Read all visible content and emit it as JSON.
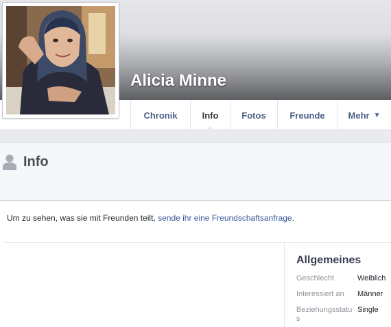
{
  "profile": {
    "name": "Alicia Minne"
  },
  "nav": {
    "tabs": [
      {
        "label": "Chronik"
      },
      {
        "label": "Info"
      },
      {
        "label": "Fotos"
      },
      {
        "label": "Freunde"
      },
      {
        "label": "Mehr"
      }
    ],
    "active_tab": "Info"
  },
  "info": {
    "title": "Info",
    "notice_text": "Um zu sehen, was sie mit Freunden teilt, ",
    "notice_link": "sende ihr eine Freundschaftsanfrage",
    "notice_end": "."
  },
  "general": {
    "title": "Allgemeines",
    "rows": [
      {
        "label": "Geschlecht",
        "value": "Weiblich"
      },
      {
        "label": "Interessiert an",
        "value": "Männer"
      },
      {
        "label": "Beziehungsstatu s",
        "value": "Single"
      }
    ]
  },
  "colors": {
    "link": "#365899",
    "tab_text": "#4b5f86",
    "header_bg": "#f6f7f9"
  }
}
